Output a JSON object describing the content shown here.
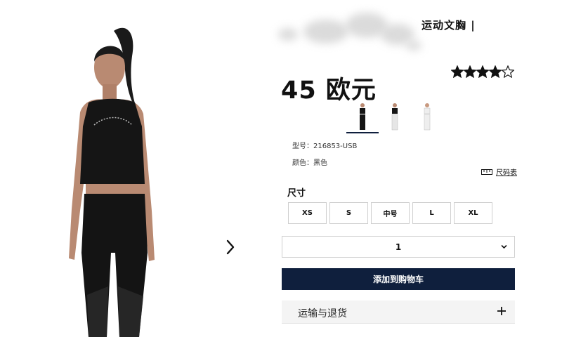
{
  "product": {
    "title_suffix": "运动文胸 |",
    "price": "45 欧元",
    "rating": 4,
    "rating_max": 5,
    "model_label": "型号",
    "model_value": "216853-USB",
    "color_label": "颜色",
    "color_value": "黑色"
  },
  "gallery": {
    "thumbnails": [
      "thumbnail-black",
      "thumbnail-white-pants",
      "thumbnail-white"
    ],
    "active_index": 0
  },
  "size_chart_label": "尺码表",
  "size_section": {
    "title": "尺寸",
    "options": [
      "XS",
      "S",
      "中号",
      "L",
      "XL"
    ]
  },
  "quantity": {
    "value": "1"
  },
  "cart": {
    "add_label": "添加到购物车"
  },
  "shipping": {
    "label": "运输与退货"
  },
  "colors": {
    "accent": "#0f1f3d",
    "star": "#111111"
  },
  "icons": [
    "next-arrow-icon",
    "star-icon",
    "ruler-icon",
    "chevron-down-icon",
    "plus-icon"
  ]
}
